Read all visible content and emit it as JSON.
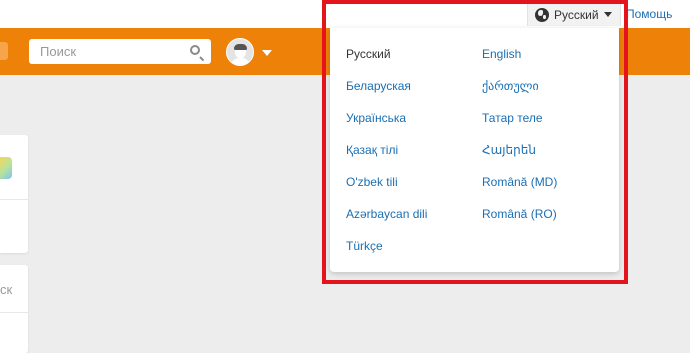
{
  "topbar": {
    "language_label": "Русский",
    "help_label": "Помощь"
  },
  "header": {
    "search": {
      "placeholder": "Поиск",
      "value": ""
    }
  },
  "left_cards": {
    "card2_text": "ск"
  },
  "language_menu": {
    "left_column": [
      {
        "label": "Русский",
        "current": true
      },
      {
        "label": "Беларуская",
        "current": false
      },
      {
        "label": "Українська",
        "current": false
      },
      {
        "label": "Қазақ тілі",
        "current": false
      },
      {
        "label": "O'zbek tili",
        "current": false
      },
      {
        "label": "Azərbaycan dili",
        "current": false
      },
      {
        "label": "Türkçe",
        "current": false
      }
    ],
    "right_column": [
      {
        "label": "English"
      },
      {
        "label": "ქართული"
      },
      {
        "label": "Татар теле"
      },
      {
        "label": "Հայերեն"
      },
      {
        "label": "Română (MD)"
      },
      {
        "label": "Română (RO)"
      }
    ]
  },
  "colors": {
    "header_orange": "#ee8208",
    "link_blue": "#1a6fb3",
    "highlight_red": "#e3141c",
    "page_background": "#ededed"
  }
}
